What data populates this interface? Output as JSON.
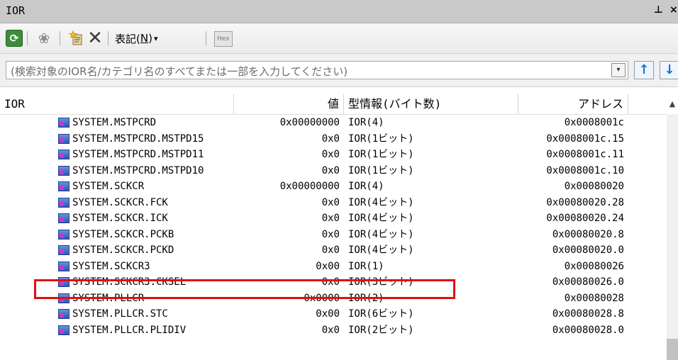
{
  "window": {
    "title": "IOR",
    "pin_glyph": "ᵖ",
    "close_glyph": "✕"
  },
  "toolbar": {
    "view_label_prefix": "表記(",
    "view_label_key": "N",
    "view_label_suffix": ")",
    "view_arrow": "▾",
    "hex_label": "Hex"
  },
  "search": {
    "placeholder": "(検索対象のIOR名/カテゴリ名のすべてまたは一部を入力してください)"
  },
  "columns": {
    "name": "IOR",
    "value": "値",
    "type": "型情報(バイト数)",
    "address": "アドレス"
  },
  "rows": [
    {
      "name": "SYSTEM.MSTPCRD",
      "value": "0x00000000",
      "type": "IOR(4)",
      "address": "0x0008001c"
    },
    {
      "name": "SYSTEM.MSTPCRD.MSTPD15",
      "value": "0x0",
      "type": "IOR(1ビット)",
      "address": "0x0008001c.15"
    },
    {
      "name": "SYSTEM.MSTPCRD.MSTPD11",
      "value": "0x0",
      "type": "IOR(1ビット)",
      "address": "0x0008001c.11"
    },
    {
      "name": "SYSTEM.MSTPCRD.MSTPD10",
      "value": "0x0",
      "type": "IOR(1ビット)",
      "address": "0x0008001c.10"
    },
    {
      "name": "SYSTEM.SCKCR",
      "value": "0x00000000",
      "type": "IOR(4)",
      "address": "0x00080020"
    },
    {
      "name": "SYSTEM.SCKCR.FCK",
      "value": "0x0",
      "type": "IOR(4ビット)",
      "address": "0x00080020.28"
    },
    {
      "name": "SYSTEM.SCKCR.ICK",
      "value": "0x0",
      "type": "IOR(4ビット)",
      "address": "0x00080020.24"
    },
    {
      "name": "SYSTEM.SCKCR.PCKB",
      "value": "0x0",
      "type": "IOR(4ビット)",
      "address": "0x00080020.8"
    },
    {
      "name": "SYSTEM.SCKCR.PCKD",
      "value": "0x0",
      "type": "IOR(4ビット)",
      "address": "0x00080020.0"
    },
    {
      "name": "SYSTEM.SCKCR3",
      "value": "0x00",
      "type": "IOR(1)",
      "address": "0x00080026"
    },
    {
      "name": "SYSTEM.SCKCR3.CKSEL",
      "value": "0x0",
      "type": "IOR(3ビット)",
      "address": "0x00080026.0"
    },
    {
      "name": "SYSTEM.PLLCR",
      "value": "0x0000",
      "type": "IOR(2)",
      "address": "0x00080028"
    },
    {
      "name": "SYSTEM.PLLCR.STC",
      "value": "0x00",
      "type": "IOR(6ビット)",
      "address": "0x00080028.8"
    },
    {
      "name": "SYSTEM.PLLCR.PLIDIV",
      "value": "0x0",
      "type": "IOR(2ビット)",
      "address": "0x00080028.0"
    }
  ],
  "highlighted_row": "SYSTEM.SCKCR3",
  "colors": {
    "highlight_border": "#e01010",
    "titlebar": "#c9c9c9"
  }
}
